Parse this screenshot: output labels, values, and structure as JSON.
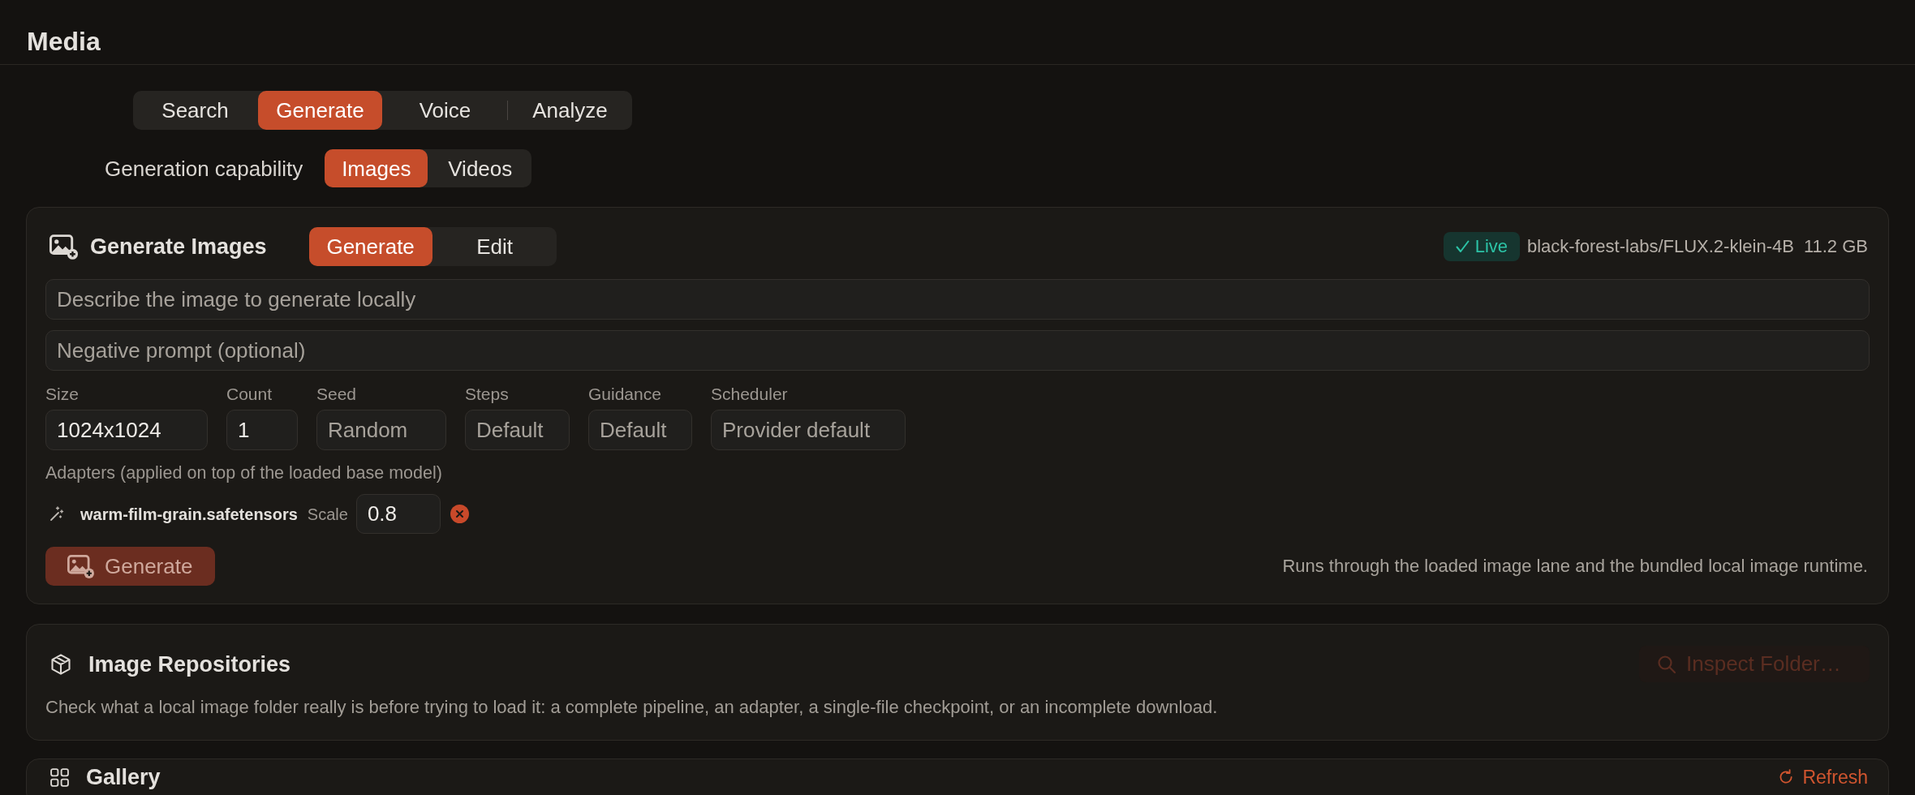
{
  "header": {
    "title": "Media"
  },
  "mode_tabs": [
    {
      "label": "Search",
      "selected": false
    },
    {
      "label": "Generate",
      "selected": true
    },
    {
      "label": "Voice",
      "selected": false
    },
    {
      "label": "Analyze",
      "selected": false
    }
  ],
  "capability": {
    "label": "Generation capability",
    "options": [
      {
        "label": "Images",
        "selected": true
      },
      {
        "label": "Videos",
        "selected": false
      }
    ]
  },
  "generate_card": {
    "title": "Generate Images",
    "modes": [
      {
        "label": "Generate",
        "selected": true
      },
      {
        "label": "Edit",
        "selected": false
      }
    ],
    "status": {
      "label": "Live",
      "model": "black-forest-labs/FLUX.2-klein-4B",
      "size": "11.2 GB"
    },
    "prompt": {
      "placeholder": "Describe the image to generate locally"
    },
    "negative_prompt": {
      "placeholder": "Negative prompt (optional)"
    },
    "params": [
      {
        "label": "Size",
        "value": "1024x1024"
      },
      {
        "label": "Count",
        "value": "1"
      },
      {
        "label": "Seed",
        "placeholder": "Random"
      },
      {
        "label": "Steps",
        "placeholder": "Default"
      },
      {
        "label": "Guidance",
        "placeholder": "Default"
      },
      {
        "label": "Scheduler",
        "placeholder": "Provider default"
      }
    ],
    "adapters_label": "Adapters (applied on top of the loaded base model)",
    "adapters": [
      {
        "name": "warm-film-grain.safetensors",
        "scale_label": "Scale",
        "scale": "0.8"
      }
    ],
    "generate_button": {
      "label": "Generate",
      "disabled": true
    },
    "note": "Runs through the loaded image lane and the bundled local image runtime."
  },
  "repositories_card": {
    "title": "Image Repositories",
    "inspect_button": {
      "label": "Inspect Folder…",
      "disabled": true
    },
    "description": "Check what a local image folder really is before trying to load it: a complete pipeline, an adapter, a single-file checkpoint, or an incomplete download."
  },
  "gallery_card": {
    "title": "Gallery",
    "refresh_button": {
      "label": "Refresh"
    }
  }
}
